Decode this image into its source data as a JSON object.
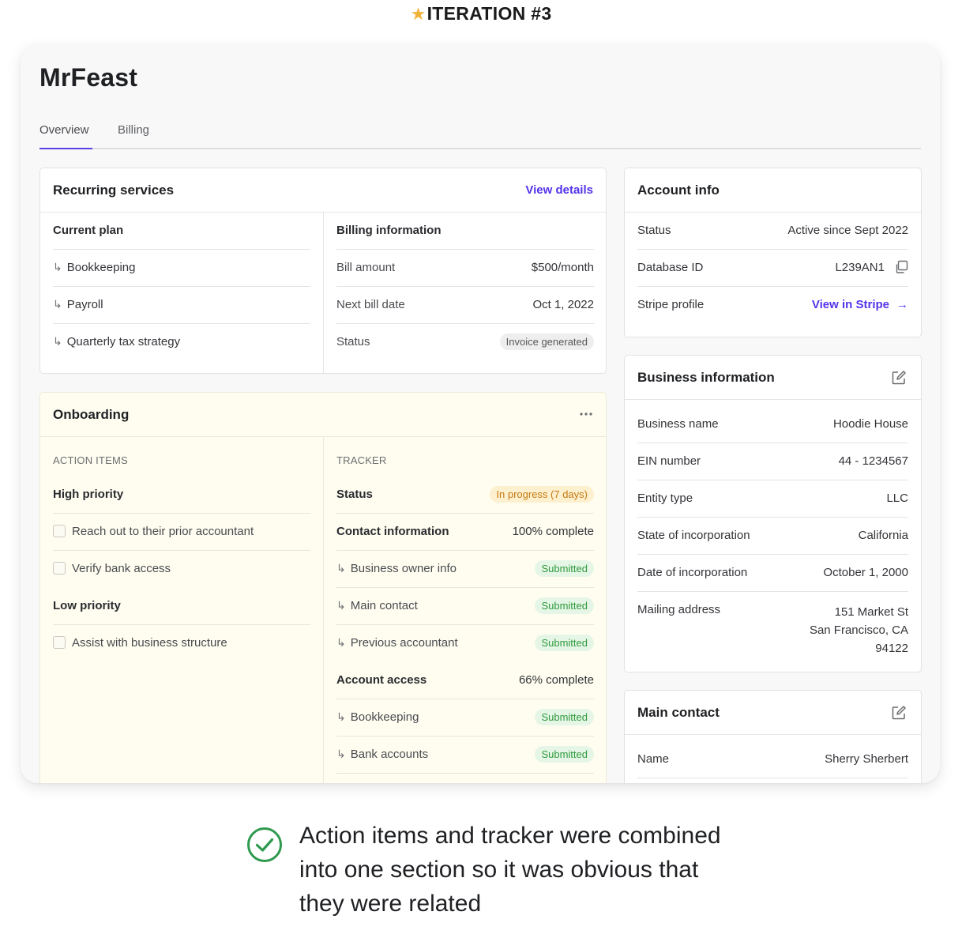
{
  "header": {
    "title": "ITERATION #3",
    "star_icon": "star-icon"
  },
  "company": "MrFeast",
  "tabs": [
    {
      "label": "Overview",
      "active": true
    },
    {
      "label": "Billing",
      "active": false
    }
  ],
  "accent_color": "#5533ea",
  "recurring": {
    "title": "Recurring services",
    "action": "View details",
    "plan_title": "Current plan",
    "plan_items": [
      "Bookkeeping",
      "Payroll",
      "Quarterly tax strategy"
    ],
    "billing_title": "Billing information",
    "billing_rows": [
      {
        "label": "Bill amount",
        "value": "$500/month"
      },
      {
        "label": "Next bill date",
        "value": "Oct 1, 2022"
      },
      {
        "label": "Status",
        "value": "Invoice generated"
      }
    ]
  },
  "onboarding": {
    "title": "Onboarding",
    "menu_icon": "more-horizontal-icon",
    "action_items_label": "ACTION ITEMS",
    "high_priority_label": "High priority",
    "high_items": [
      "Reach out to their prior accountant",
      "Verify bank access"
    ],
    "low_priority_label": "Low priority",
    "low_items": [
      "Assist with business structure"
    ],
    "tracker_label": "TRACKER",
    "status_label": "Status",
    "status_value": "In progress (7 days)",
    "contact_label": "Contact information",
    "contact_value": "100% complete",
    "contact_items": [
      {
        "label": "Business owner info",
        "status": "Submitted"
      },
      {
        "label": "Main contact",
        "status": "Submitted"
      },
      {
        "label": "Previous accountant",
        "status": "Submitted"
      }
    ],
    "access_label": "Account access",
    "access_value": "66% complete",
    "access_items": [
      {
        "label": "Bookkeeping",
        "status": "Submitted"
      },
      {
        "label": "Bank accounts",
        "status": "Submitted"
      }
    ]
  },
  "account": {
    "title": "Account info",
    "rows": [
      {
        "label": "Status",
        "value": "Active since Sept 2022"
      },
      {
        "label": "Database ID",
        "value": "L239AN1"
      },
      {
        "label": "Stripe profile",
        "value": "View in Stripe"
      }
    ]
  },
  "business": {
    "title": "Business information",
    "rows": [
      {
        "label": "Business name",
        "value": "Hoodie House"
      },
      {
        "label": "EIN number",
        "value": "44 - 1234567"
      },
      {
        "label": "Entity type",
        "value": "LLC"
      },
      {
        "label": "State of incorporation",
        "value": "California"
      },
      {
        "label": "Date of incorporation",
        "value": "October 1, 2000"
      }
    ],
    "mailing_label": "Mailing address",
    "mailing_lines": [
      "151 Market St",
      "San Francisco, CA",
      "94122"
    ]
  },
  "main_contact": {
    "title": "Main contact",
    "rows": [
      {
        "label": "Name",
        "value": "Sherry Sherbert"
      }
    ]
  },
  "footer": {
    "check_icon": "check-circle-icon",
    "check_color": "#2f9a4e",
    "message": "Action items and tracker were combined into one section so it was obvious that they were related"
  }
}
